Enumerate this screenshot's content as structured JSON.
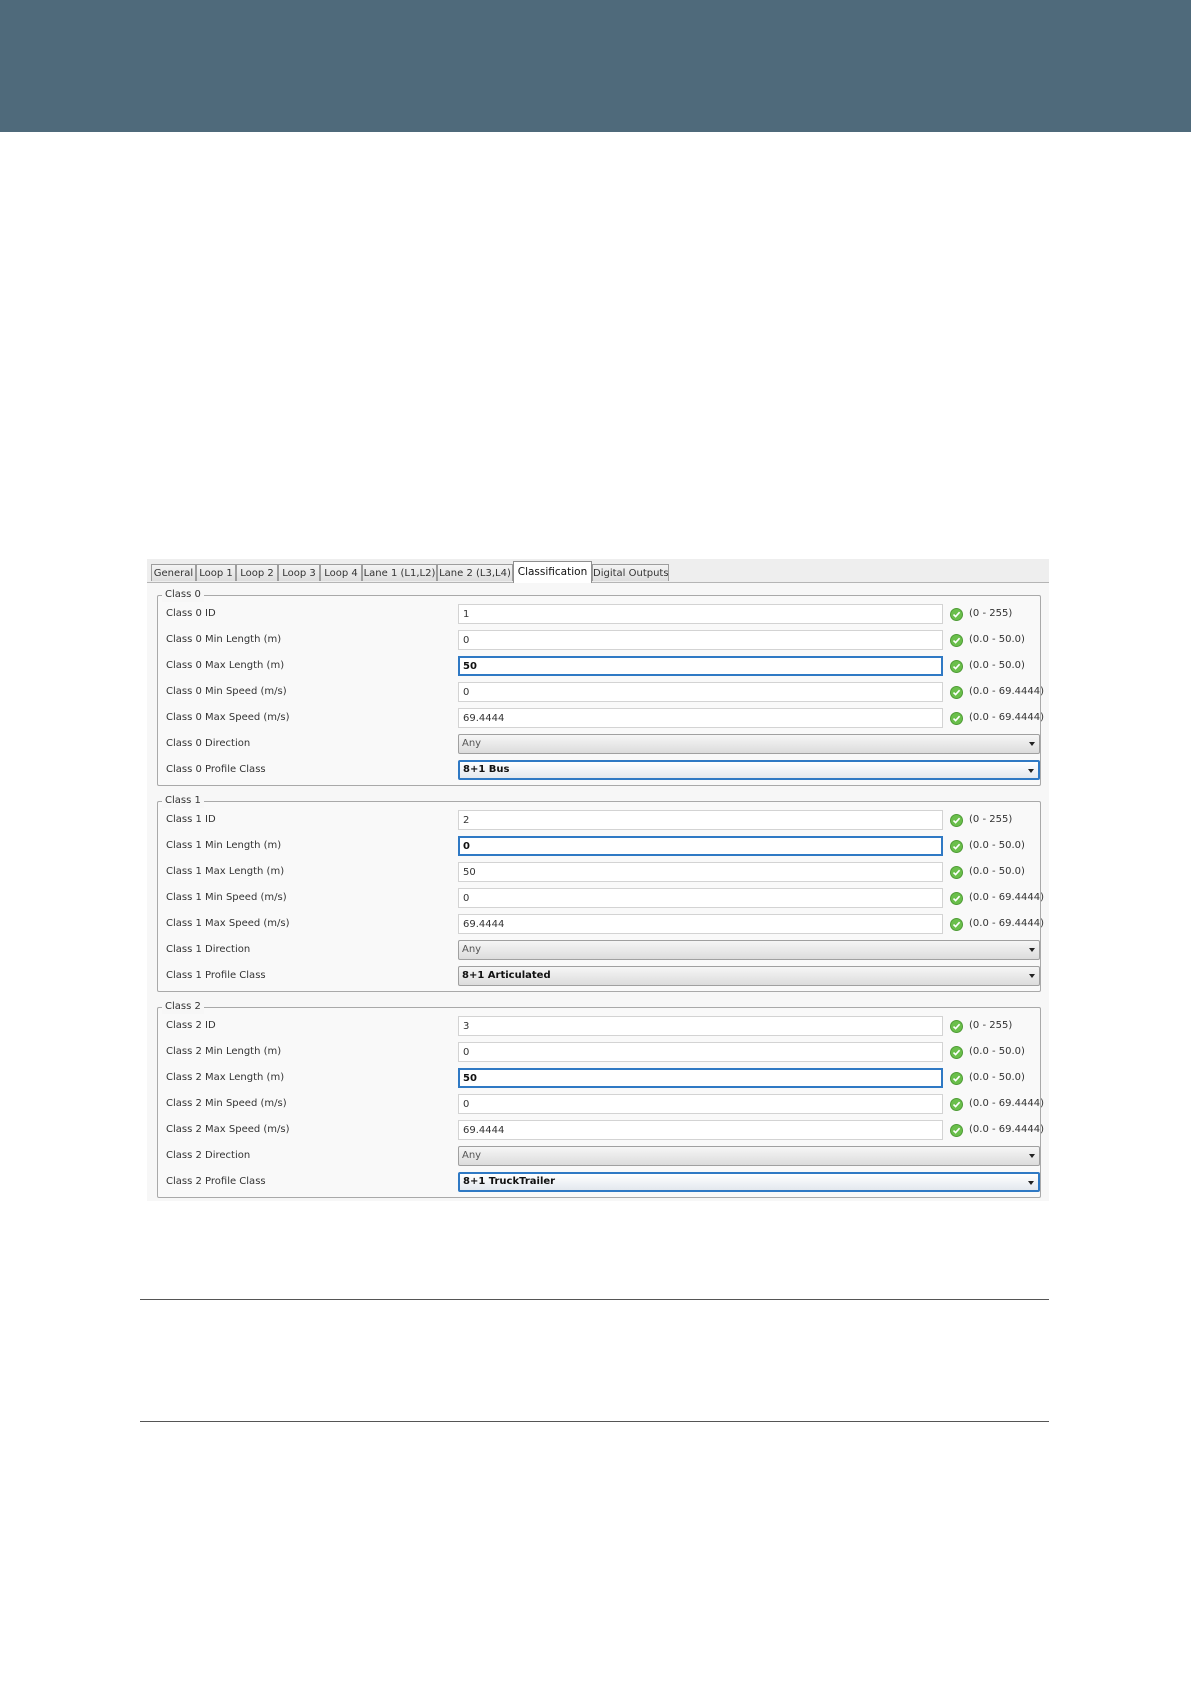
{
  "tabs": [
    {
      "label": "General",
      "active": false
    },
    {
      "label": "Loop 1",
      "active": false
    },
    {
      "label": "Loop 2",
      "active": false
    },
    {
      "label": "Loop 3",
      "active": false
    },
    {
      "label": "Loop 4",
      "active": false
    },
    {
      "label": "Lane 1 (L1,L2)",
      "active": false
    },
    {
      "label": "Lane 2 (L3,L4)",
      "active": false
    },
    {
      "label": "Classification",
      "active": true
    },
    {
      "label": "Digital Outputs",
      "active": false
    }
  ],
  "classes": [
    {
      "title": "Class 0",
      "fields": [
        {
          "label": "Class 0 ID",
          "value": "1",
          "range": "(0 - 255)"
        },
        {
          "label": "Class 0 Min Length (m)",
          "value": "0",
          "range": "(0.0 - 50.0)"
        },
        {
          "label": "Class 0 Max Length (m)",
          "value": "50",
          "range": "(0.0 - 50.0)"
        },
        {
          "label": "Class 0 Min Speed (m/s)",
          "value": "0",
          "range": "(0.0 - 69.4444)"
        },
        {
          "label": "Class 0 Max Speed (m/s)",
          "value": "69.4444",
          "range": "(0.0 - 69.4444)"
        }
      ],
      "direction": {
        "label": "Class 0 Direction",
        "value": "Any"
      },
      "profile": {
        "label": "Class 0 Profile Class",
        "value": "8+1 Bus"
      }
    },
    {
      "title": "Class 1",
      "fields": [
        {
          "label": "Class 1 ID",
          "value": "2",
          "range": "(0 - 255)"
        },
        {
          "label": "Class 1 Min Length (m)",
          "value": "0",
          "range": "(0.0 - 50.0)"
        },
        {
          "label": "Class 1 Max Length (m)",
          "value": "50",
          "range": "(0.0 - 50.0)"
        },
        {
          "label": "Class 1 Min Speed (m/s)",
          "value": "0",
          "range": "(0.0 - 69.4444)"
        },
        {
          "label": "Class 1 Max Speed (m/s)",
          "value": "69.4444",
          "range": "(0.0 - 69.4444)"
        }
      ],
      "direction": {
        "label": "Class 1 Direction",
        "value": "Any"
      },
      "profile": {
        "label": "Class 1 Profile Class",
        "value": "8+1 Articulated"
      }
    },
    {
      "title": "Class 2",
      "fields": [
        {
          "label": "Class 2 ID",
          "value": "3",
          "range": "(0 - 255)"
        },
        {
          "label": "Class 2 Min Length (m)",
          "value": "0",
          "range": "(0.0 - 50.0)"
        },
        {
          "label": "Class 2 Max Length (m)",
          "value": "50",
          "range": "(0.0 - 50.0)"
        },
        {
          "label": "Class 2 Min Speed (m/s)",
          "value": "0",
          "range": "(0.0 - 69.4444)"
        },
        {
          "label": "Class 2 Max Speed (m/s)",
          "value": "69.4444",
          "range": "(0.0 - 69.4444)"
        }
      ],
      "direction": {
        "label": "Class 2 Direction",
        "value": "Any"
      },
      "profile": {
        "label": "Class 2 Profile Class",
        "value": "8+1 TruckTrailer"
      }
    }
  ],
  "colors": {
    "header_band": "#4f6a7b",
    "focus": "#2f79c4",
    "valid": "#6abf4b"
  }
}
